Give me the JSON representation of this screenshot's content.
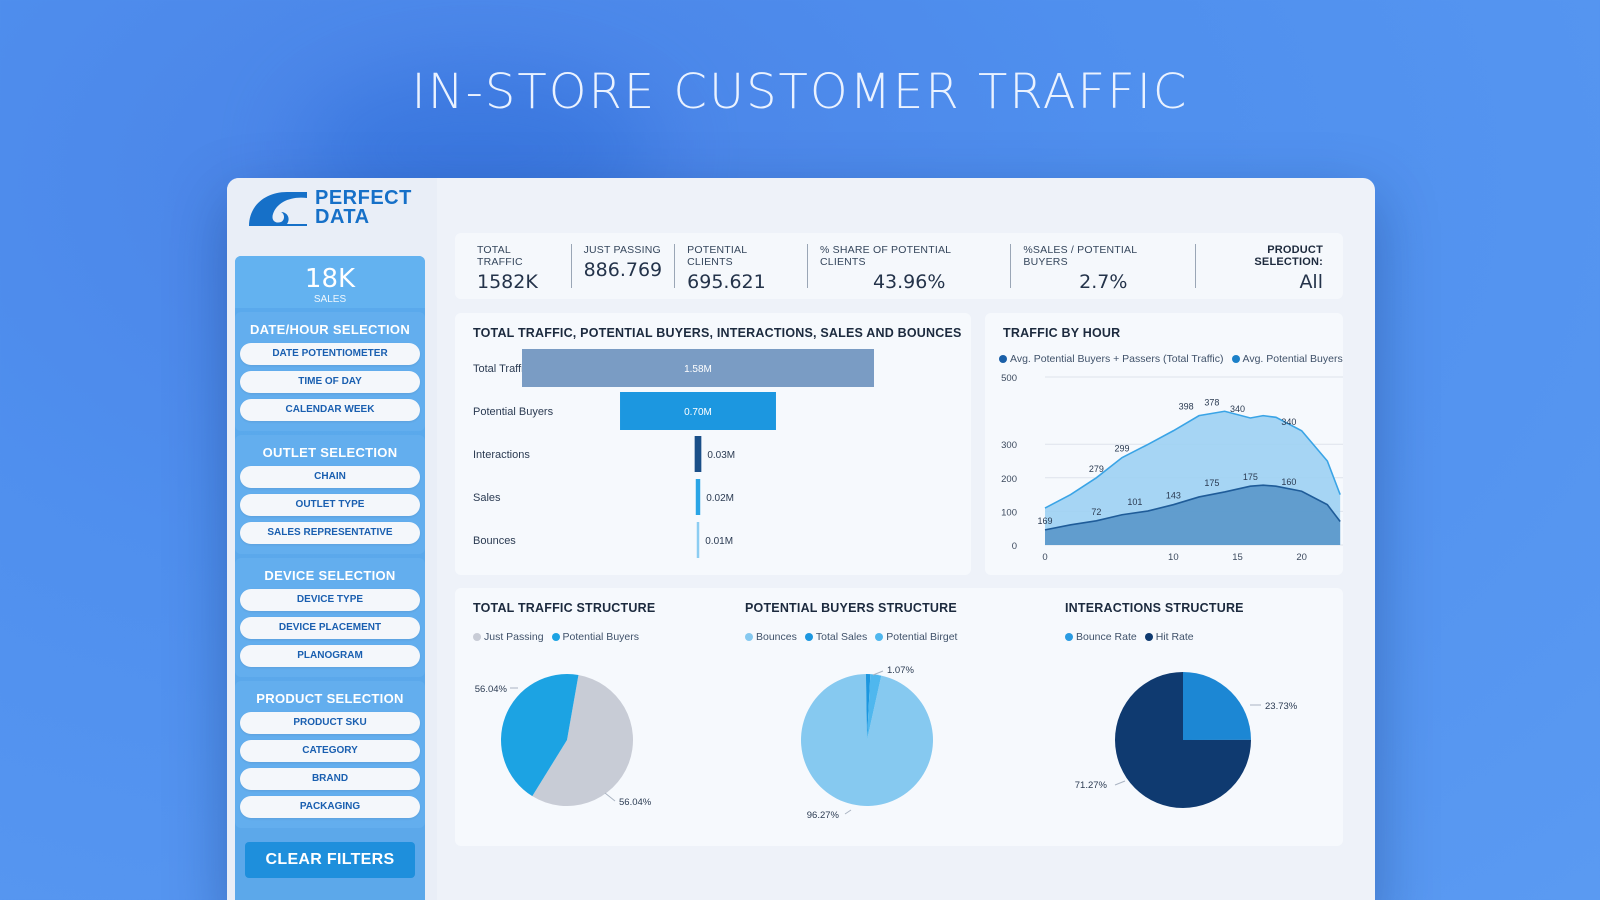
{
  "headline": "IN-STORE CUSTOMER TRAFFIC",
  "logo": {
    "line1": "PERFECT",
    "line2": "DATA"
  },
  "sidebar": {
    "kpi_value": "18K",
    "kpi_label": "SALES",
    "groups": [
      {
        "title": "DATE/HOUR SELECTION",
        "items": [
          "DATE POTENTIOMETER",
          "TIME OF DAY",
          "CALENDAR WEEK"
        ]
      },
      {
        "title": "OUTLET SELECTION",
        "items": [
          "CHAIN",
          "OUTLET TYPE",
          "SALES REPRESENTATIVE"
        ]
      },
      {
        "title": "DEVICE SELECTION",
        "items": [
          "DEVICE TYPE",
          "DEVICE PLACEMENT",
          "PLANOGRAM"
        ]
      },
      {
        "title": "PRODUCT SELECTION",
        "items": [
          "PRODUCT SKU",
          "CATEGORY",
          "BRAND",
          "PACKAGING"
        ]
      }
    ],
    "clear_label": "CLEAR FILTERS"
  },
  "kpis": [
    {
      "label": "TOTAL TRAFFIC",
      "value": "1582K"
    },
    {
      "label": "JUST PASSING",
      "value": "886.769"
    },
    {
      "label": "POTENTIAL CLIENTS",
      "value": "695.621"
    },
    {
      "label": "% SHARE OF POTENTIAL CLIENTS",
      "value": "43.96%"
    },
    {
      "label": "%SALES / POTENTIAL BUYERS",
      "value": "2.7%"
    }
  ],
  "product_selection": {
    "label": "PRODUCT SELECTION:",
    "value": "All"
  },
  "colors": {
    "accent": "#1e8fdc",
    "bar_total": "#7a9cc4",
    "bar_buyers": "#1c97e0",
    "dark_navy": "#0f3a70",
    "light_blue": "#86c9f0",
    "grey": "#c8ccd6"
  },
  "chart_data": [
    {
      "type": "bar",
      "title": "TOTAL TRAFFIC, POTENTIAL BUYERS, INTERACTIONS, SALES AND BOUNCES",
      "categories": [
        "Total Traffic",
        "Potential Buyers",
        "Interactions",
        "Sales",
        "Bounces"
      ],
      "values": [
        1.58,
        0.7,
        0.03,
        0.02,
        0.01
      ],
      "value_labels": [
        "1.58M",
        "0.70M",
        "0.03M",
        "0.02M",
        "0.01M"
      ]
    },
    {
      "type": "area",
      "title": "TRAFFIC BY HOUR",
      "ylim": [
        0,
        500
      ],
      "xlim": [
        0,
        24
      ],
      "yticks": [
        0,
        100,
        200,
        300,
        500
      ],
      "xticks": [
        0,
        10,
        15,
        20
      ],
      "series": [
        {
          "name": "Avg. Potential Buyers + Passers (Total Traffic)",
          "x": [
            0,
            2,
            4,
            6,
            8,
            10,
            12,
            14,
            16,
            17,
            18,
            20,
            22,
            23
          ],
          "values": [
            110,
            150,
            200,
            260,
            299,
            340,
            385,
            398,
            378,
            385,
            380,
            340,
            250,
            150
          ],
          "labels": {
            "4": "279",
            "6": "299",
            "11": "398",
            "13": "378",
            "15": "340",
            "19": "340"
          }
        },
        {
          "name": "Avg. Potential Buyers",
          "x": [
            0,
            2,
            4,
            6,
            8,
            10,
            12,
            14,
            16,
            17,
            18,
            20,
            22,
            23
          ],
          "values": [
            45,
            60,
            72,
            90,
            101,
            120,
            143,
            158,
            175,
            178,
            175,
            160,
            120,
            70
          ],
          "labels": {
            "0": "169",
            "4": "72",
            "7": "101",
            "10": "143",
            "13": "175",
            "16": "175",
            "19": "160"
          }
        }
      ]
    },
    {
      "type": "pie",
      "title": "TOTAL TRAFFIC STRUCTURE",
      "slices": [
        {
          "name": "Just Passing",
          "value": 56.04,
          "label": "56.04%"
        },
        {
          "name": "Potential Buyers",
          "value": 43.96,
          "label": "56.04%"
        }
      ]
    },
    {
      "type": "pie",
      "title": "POTENTIAL BUYERS STRUCTURE",
      "slices": [
        {
          "name": "Bounces",
          "value": 96.27,
          "label": "96.27%"
        },
        {
          "name": "Total Sales",
          "value": 1.07,
          "label": "1.07%"
        },
        {
          "name": "Potential Birget",
          "value": 2.66,
          "label": ""
        }
      ]
    },
    {
      "type": "pie",
      "title": "INTERACTIONS STRUCTURE",
      "slices": [
        {
          "name": "Bounce Rate",
          "value": 23.73,
          "label": "23.73%"
        },
        {
          "name": "Hit Rate",
          "value": 71.27,
          "label": "71.27%"
        }
      ]
    }
  ]
}
